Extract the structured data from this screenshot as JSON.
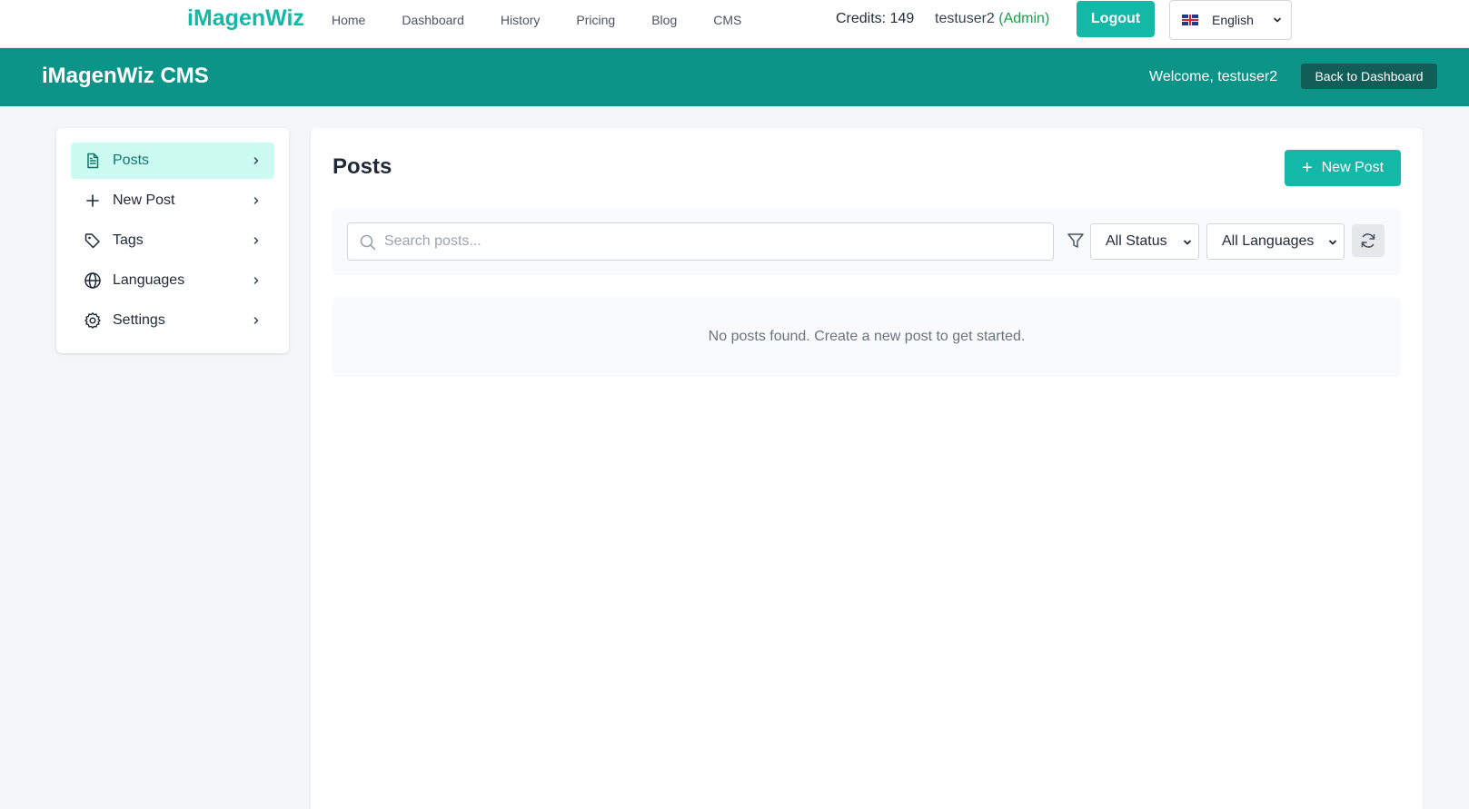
{
  "topnav": {
    "brand": "iMagenWiz",
    "links": [
      "Home",
      "Dashboard",
      "History",
      "Pricing",
      "Blog",
      "CMS"
    ],
    "credits": "Credits: 149",
    "username": "testuser2",
    "role": "(Admin)",
    "logout_label": "Logout",
    "language": "English",
    "language_flag": "uk-flag-icon"
  },
  "cms_header": {
    "title": "iMagenWiz CMS",
    "welcome": "Welcome, testuser2",
    "back_label": "Back to Dashboard"
  },
  "sidebar": {
    "items": [
      {
        "label": "Posts",
        "icon": "document-icon",
        "active": true
      },
      {
        "label": "New Post",
        "icon": "plus-icon",
        "active": false
      },
      {
        "label": "Tags",
        "icon": "tag-icon",
        "active": false
      },
      {
        "label": "Languages",
        "icon": "globe-icon",
        "active": false
      },
      {
        "label": "Settings",
        "icon": "gear-icon",
        "active": false
      }
    ]
  },
  "main": {
    "title": "Posts",
    "new_post_label": "New Post",
    "search": {
      "placeholder": "Search posts...",
      "value": ""
    },
    "status_filter": "All Status",
    "language_filter": "All Languages",
    "empty_message": "No posts found. Create a new post to get started."
  },
  "colors": {
    "accent": "#14b8a6",
    "header_bg": "#0d9488",
    "active_item_bg": "#ccfbf1",
    "admin_text": "#16a34a"
  }
}
